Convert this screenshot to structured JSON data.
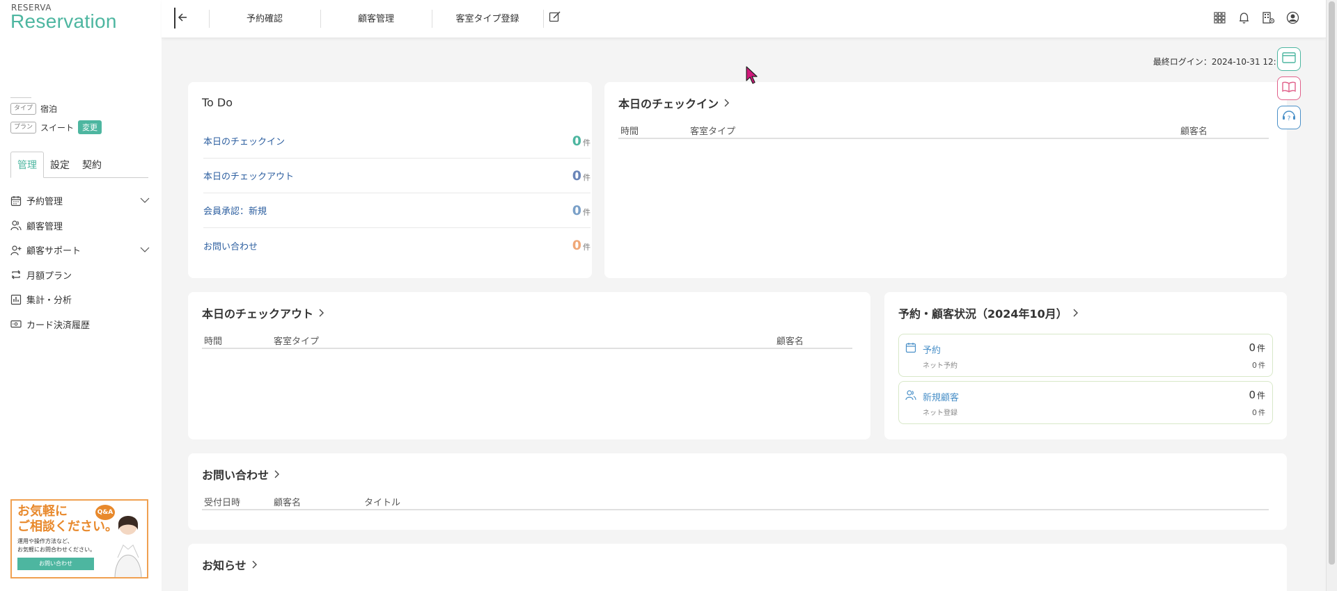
{
  "brand": {
    "top": "RESERVA",
    "name": "Reservation"
  },
  "sidebar": {
    "type_tag": "タイプ",
    "type_value": "宿泊",
    "plan_tag": "プラン",
    "plan_value": "スイート",
    "change_label": "変更",
    "tabs": [
      {
        "label": "管理",
        "active": true
      },
      {
        "label": "設定",
        "active": false
      },
      {
        "label": "契約",
        "active": false
      }
    ],
    "menu": [
      {
        "label": "予約管理",
        "icon": "calendar-icon",
        "expandable": true
      },
      {
        "label": "顧客管理",
        "icon": "users-icon",
        "expandable": false
      },
      {
        "label": "顧客サポート",
        "icon": "user-plus-icon",
        "expandable": true
      },
      {
        "label": "月額プラン",
        "icon": "repeat-icon",
        "expandable": false
      },
      {
        "label": "集計・分析",
        "icon": "bar-chart-icon",
        "expandable": false
      },
      {
        "label": "カード決済履歴",
        "icon": "card-icon",
        "expandable": false
      }
    ],
    "banner": {
      "title_line1": "お気軽に",
      "title_line2": "ご相談ください。",
      "text_line1": "運用や操作方法など、",
      "text_line2": "お気軽にお問合わせください。",
      "button": "お問い合わせ",
      "badge": "Q&A"
    }
  },
  "topbar": {
    "links": [
      "予約確認",
      "顧客管理",
      "客室タイプ登録"
    ]
  },
  "last_login": "最終ログイン：2024-10-31 12:19",
  "todo": {
    "title": "To Do",
    "unit": "件",
    "rows": [
      {
        "label": "本日のチェックイン",
        "count": "0",
        "color": "#4db6a0"
      },
      {
        "label": "本日のチェックアウト",
        "count": "0",
        "color": "#6a85b8"
      },
      {
        "label": "会員承認：新規",
        "count": "0",
        "color": "#7aa0c8"
      },
      {
        "label": "お問い合わせ",
        "count": "0",
        "color": "#f0a878"
      }
    ]
  },
  "checkin": {
    "title": "本日のチェックイン",
    "headers": [
      "時間",
      "客室タイプ",
      "顧客名"
    ]
  },
  "checkout": {
    "title": "本日のチェックアウト",
    "headers": [
      "時間",
      "客室タイプ",
      "顧客名"
    ]
  },
  "status": {
    "title": "予約・顧客状況（2024年10月）",
    "unit": "件",
    "items": [
      {
        "label": "予約",
        "sub": "ネット予約",
        "main": "0",
        "minor": "0"
      },
      {
        "label": "新規顧客",
        "sub": "ネット登録",
        "main": "0",
        "minor": "0"
      }
    ]
  },
  "inquiry": {
    "title": "お問い合わせ",
    "headers": [
      "受付日時",
      "顧客名",
      "タイトル"
    ]
  },
  "news": {
    "title": "お知らせ"
  },
  "colors": {
    "accent": "#4db6a0",
    "link": "#2d5fa0",
    "banner": "#e8892c"
  }
}
